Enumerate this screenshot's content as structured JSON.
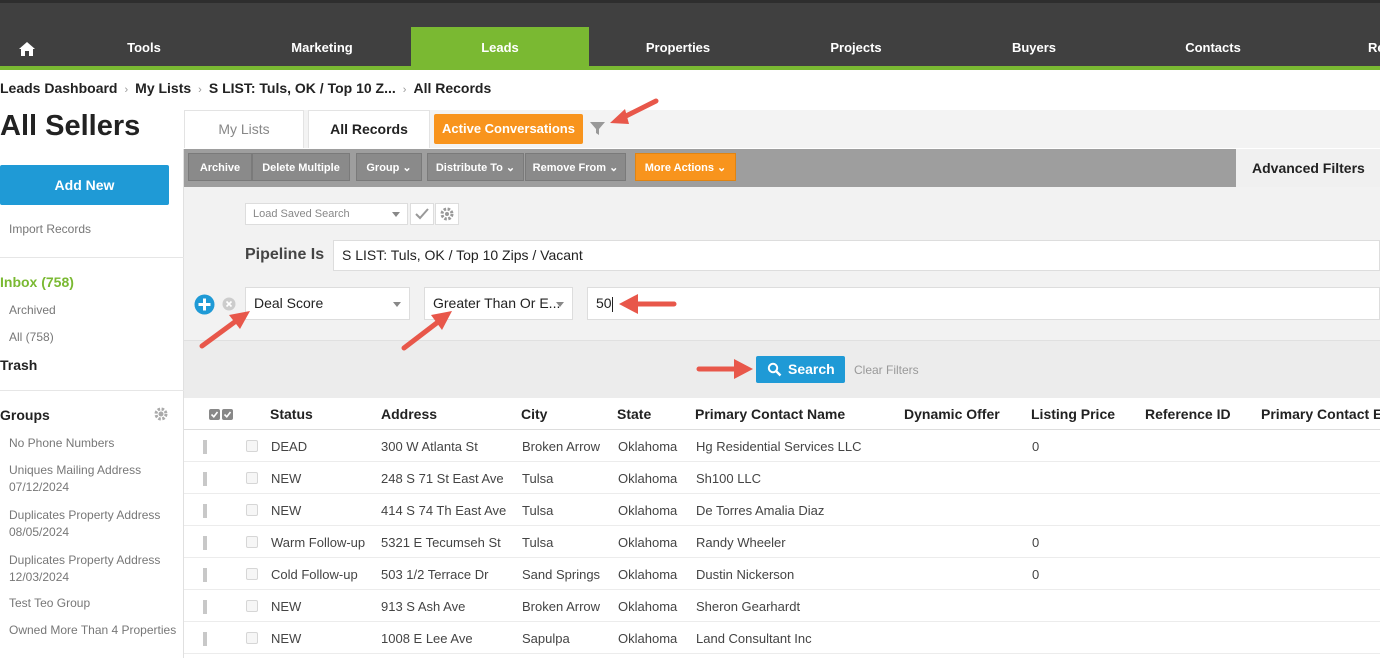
{
  "nav": {
    "items": [
      "Tools",
      "Marketing",
      "Leads",
      "Properties",
      "Projects",
      "Buyers",
      "Contacts",
      "Re"
    ],
    "active": "Leads"
  },
  "breadcrumb": [
    "Leads Dashboard",
    "My Lists",
    "S LIST: Tuls, OK / Top 10 Z...",
    "All Records"
  ],
  "page_title": "All Sellers",
  "tabs": {
    "my_lists": "My Lists",
    "all_records": "All Records",
    "active_conversations": "Active Conversations"
  },
  "sidebar": {
    "add_new": "Add New",
    "import": "Import Records",
    "inbox": "Inbox (758)",
    "archived": "Archived",
    "all": "All (758)",
    "trash": "Trash",
    "groups_title": "Groups",
    "groups": [
      "No Phone Numbers",
      "Uniques Mailing Address 07/12/2024",
      "Duplicates Property Address 08/05/2024",
      "Duplicates Property Address 12/03/2024",
      "Test Teo Group",
      "Owned More Than 4 Properties"
    ]
  },
  "toolbar": {
    "archive": "Archive",
    "delete_multiple": "Delete Multiple",
    "group": "Group",
    "distribute_to": "Distribute To",
    "remove_from": "Remove From",
    "more_actions": "More Actions",
    "advanced_filters": "Advanced Filters"
  },
  "filters": {
    "saved_search_placeholder": "Load Saved Search",
    "pipeline_label": "Pipeline Is",
    "pipeline_value": "S LIST: Tuls, OK / Top 10 Zips / Vacant",
    "field": "Deal Score",
    "operator": "Greater Than Or E...",
    "value": "50",
    "search_label": "Search",
    "clear_label": "Clear Filters"
  },
  "table": {
    "columns": [
      "Status",
      "Address",
      "City",
      "State",
      "Primary Contact Name",
      "Dynamic Offer",
      "Listing Price",
      "Reference ID",
      "Primary Contact E"
    ],
    "rows": [
      {
        "status": "DEAD",
        "address": "300 W Atlanta St",
        "city": "Broken Arrow",
        "state": "Oklahoma",
        "contact": "Hg Residential Services LLC",
        "listing_price": "0"
      },
      {
        "status": "NEW",
        "address": "248 S 71 St East Ave",
        "city": "Tulsa",
        "state": "Oklahoma",
        "contact": "Sh100 LLC",
        "listing_price": ""
      },
      {
        "status": "NEW",
        "address": "414 S 74 Th East Ave",
        "city": "Tulsa",
        "state": "Oklahoma",
        "contact": "De Torres Amalia Diaz",
        "listing_price": ""
      },
      {
        "status": "Warm Follow-up",
        "address": "5321 E Tecumseh St",
        "city": "Tulsa",
        "state": "Oklahoma",
        "contact": "Randy Wheeler",
        "listing_price": "0"
      },
      {
        "status": "Cold Follow-up",
        "address": "503 1/2 Terrace Dr",
        "city": "Sand Springs",
        "state": "Oklahoma",
        "contact": "Dustin Nickerson",
        "listing_price": "0"
      },
      {
        "status": "NEW",
        "address": "913 S Ash Ave",
        "city": "Broken Arrow",
        "state": "Oklahoma",
        "contact": "Sheron Gearhardt",
        "listing_price": ""
      },
      {
        "status": "NEW",
        "address": "1008 E Lee Ave",
        "city": "Sapulpa",
        "state": "Oklahoma",
        "contact": "Land Consultant Inc",
        "listing_price": ""
      }
    ]
  },
  "colors": {
    "brand_green": "#7ab932",
    "accent_orange": "#f8941d",
    "primary_blue": "#1f9ad6",
    "annotation_red": "#e8574a"
  }
}
